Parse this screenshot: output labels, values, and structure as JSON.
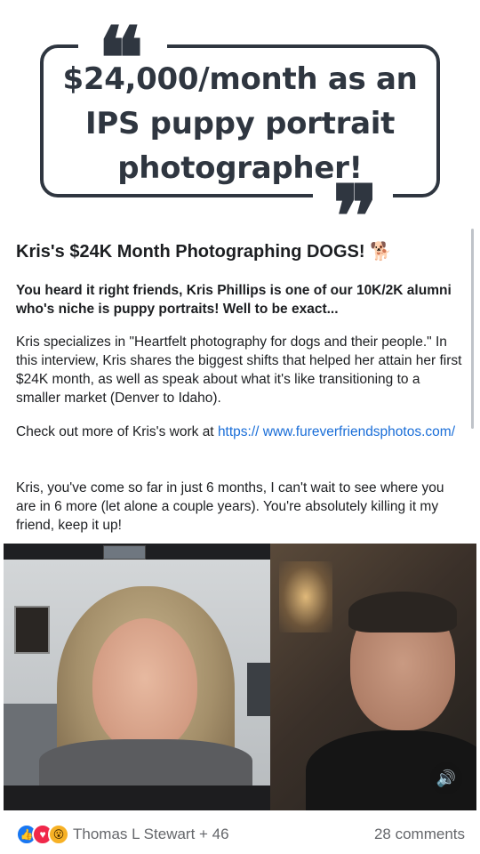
{
  "header": {
    "headline": "$24,000/month as an IPS puppy portrait photographer!",
    "open_quote": "❝",
    "close_quote": "❞"
  },
  "post": {
    "title": "Kris's $24K Month Photographing DOGS!",
    "title_emoji": "🐕",
    "lead": "You heard it right friends, Kris Phillips is one of our 10K/2K alumni who's niche is puppy portraits! Well to be exact...",
    "paragraph_1": "Kris specializes in \"Heartfelt photography for dogs and their people.\" In this interview, Kris shares the biggest shifts that helped her attain her first $24K month, as well as speak about what it's like transitioning to a smaller market (Denver to Idaho).",
    "paragraph_2_prefix": "Check out more of Kris's work at ",
    "paragraph_2_link": "https:// www.fureverfriendsphotos.com/",
    "paragraph_3": "Kris, you've come so far in just 6 months, I can't wait to see where you are in 6 more (let alone a couple years). You're absolutely killing it my friend, keep it up!"
  },
  "video": {
    "sound_icon": "🔊"
  },
  "footer": {
    "reactions": [
      "like",
      "love",
      "wow"
    ],
    "reactor_names": "Thomas L Stewart + 46",
    "comments": "28 comments"
  },
  "colors": {
    "headline": "#2f3640",
    "link": "#1a6ed8",
    "like": "#1877f2",
    "love": "#f0284a",
    "wow": "#f7b125"
  }
}
